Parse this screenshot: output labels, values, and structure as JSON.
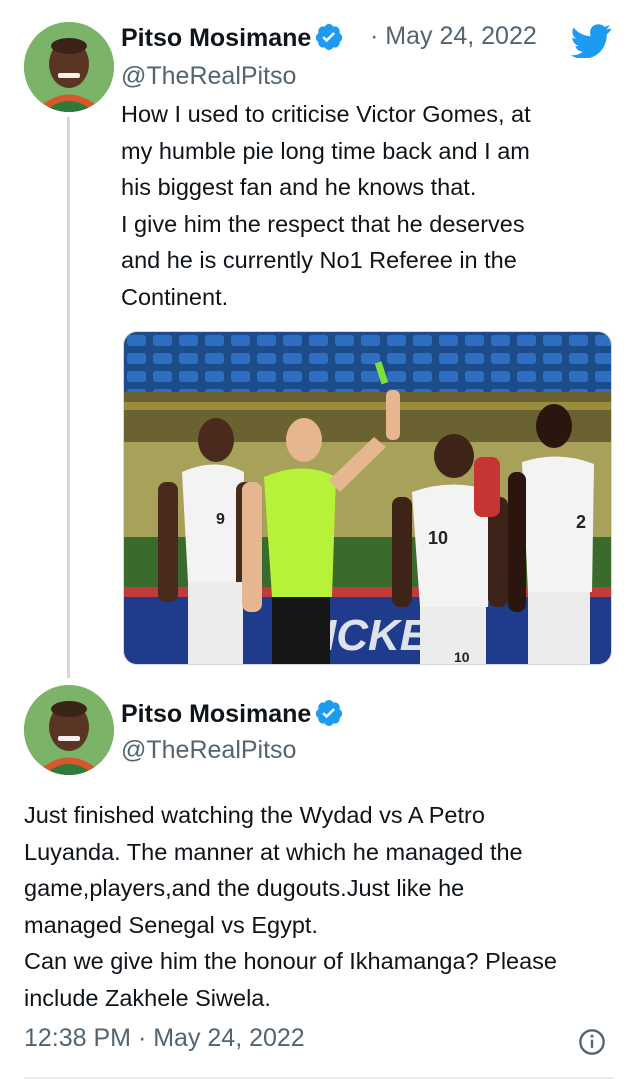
{
  "tweet1": {
    "name": "Pitso Mosimane",
    "handle": "@TheRealPitso",
    "date": "· May 24, 2022",
    "text": "How I used to criticise Victor Gomes, at\nmy humble pie long time back and I am\nhis biggest fan and he knows that.\nI give him the respect that he deserves\nand he is currently No1 Referee in the\nContinent.",
    "media_jersey_numbers": [
      "9",
      "10",
      "10",
      "2"
    ],
    "media_board_text": "ICKE"
  },
  "tweet2": {
    "name": "Pitso Mosimane",
    "handle": "@TheRealPitso",
    "text": "Just finished watching the Wydad vs A Petro\nLuyanda. The manner at which he managed the\ngame,players,and the dugouts.Just like he\nmanaged  Senegal vs Egypt.\nCan we give him the honour of Ikhamanga? Please\ninclude Zakhele Siwela.",
    "timestamp": "12:38 PM · May 24, 2022"
  },
  "colors": {
    "verified": "#1d9bf0",
    "twitter_blue": "#1d9bf0",
    "secondary_text": "#536471",
    "referee_shirt": "#b7f23a"
  },
  "icons": [
    "verified-badge-icon",
    "twitter-bird-icon",
    "info-icon"
  ]
}
